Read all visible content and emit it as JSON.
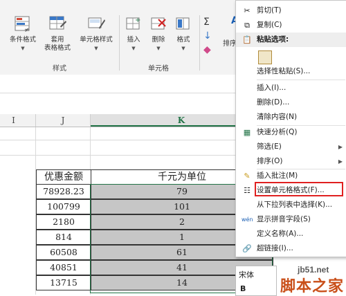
{
  "ribbon": {
    "buttons": [
      {
        "label": "条件格式",
        "arrow": "▼"
      },
      {
        "label": "套用",
        "label2": "表格格式",
        "arrow": "▼"
      },
      {
        "label": "单元格样式",
        "arrow": "▼"
      },
      {
        "label": "插入",
        "arrow": "▼"
      },
      {
        "label": "删除",
        "arrow": "▼"
      },
      {
        "label": "格式",
        "arrow": "▼"
      }
    ],
    "groups": {
      "styles": "样式",
      "cells": "单元格"
    },
    "sort_label": "排序",
    "edit_icons": {
      "sum": "Σ",
      "fill": "↓",
      "clear": "◆"
    }
  },
  "columns": {
    "i": "I",
    "j": "J",
    "k": "K"
  },
  "table": {
    "headers": {
      "j": "优惠金额",
      "k": "千元为单位"
    },
    "rows": [
      {
        "j": "78928.23",
        "k": "79"
      },
      {
        "j": "100799",
        "k": "101"
      },
      {
        "j": "2180",
        "k": "2"
      },
      {
        "j": "814",
        "k": "1"
      },
      {
        "j": "60508",
        "k": "61"
      },
      {
        "j": "40851",
        "k": "41"
      },
      {
        "j": "13715",
        "k": "14"
      }
    ]
  },
  "context_menu": {
    "cut": "剪切(T)",
    "copy": "复制(C)",
    "paste_options": "粘贴选项:",
    "paste_special": "选择性粘贴(S)...",
    "insert": "插入(I)...",
    "delete": "删除(D)...",
    "clear": "清除内容(N)",
    "quick_analysis": "快速分析(Q)",
    "filter": "筛选(E)",
    "sort": "排序(O)",
    "insert_comment": "插入批注(M)",
    "format_cells": "设置单元格格式(F)...",
    "pick_from_list": "从下拉列表中选择(K)...",
    "phonetic": "显示拼音字段(S)",
    "define_name": "定义名称(A)...",
    "hyperlink": "超链接(I)...",
    "submenu_arrow": "▶"
  },
  "mini_toolbar": {
    "font": "宋体",
    "bold": "B"
  },
  "watermark": {
    "site": "jb51.net",
    "brand": "脚本之家"
  }
}
